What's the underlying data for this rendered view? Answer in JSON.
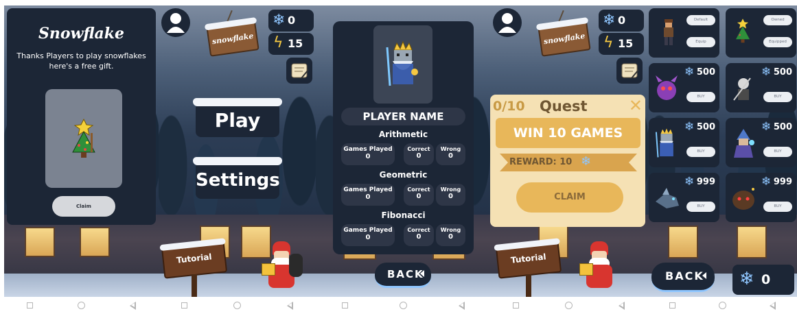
{
  "panels": {
    "gift": {
      "title": "Snowflake",
      "message": "Thanks Players to play snowflakes here's a free gift.",
      "claim_label": "Claim",
      "gift_icon": "star-tree-sprite-icon"
    },
    "main_menu": {
      "snowflakes": "0",
      "energy": "15",
      "sign_text": "snowflake",
      "play_label": "Play",
      "settings_label": "Settings",
      "tutorial_label": "Tutorial",
      "profile_icon": "user-icon",
      "quest_icon": "scroll-icon"
    },
    "profile": {
      "player_name": "PLAYER NAME",
      "back_label": "BACK",
      "sections": [
        {
          "title": "Arithmetic",
          "games_played_label": "Games Played",
          "games_played": "0",
          "correct_label": "Correct",
          "correct": "0",
          "wrong_label": "Wrong",
          "wrong": "0"
        },
        {
          "title": "Geometric",
          "games_played_label": "Games Played",
          "games_played": "0",
          "correct_label": "Correct",
          "correct": "0",
          "wrong_label": "Wrong",
          "wrong": "0"
        },
        {
          "title": "Fibonacci",
          "games_played_label": "Games Played",
          "games_played": "0",
          "correct_label": "Correct",
          "correct": "0",
          "wrong_label": "Wrong",
          "wrong": "0"
        }
      ]
    },
    "quest": {
      "snowflakes": "0",
      "energy": "15",
      "sign_text": "snowflake",
      "tutorial_label": "Tutorial",
      "progress": "0/10",
      "title": "Quest",
      "close": "✕",
      "goal": "WIN 10 GAMES",
      "reward_label": "REWARD: 10",
      "claim_label": "CLAIM"
    },
    "shop": {
      "back_label": "BACK",
      "balance": "0",
      "items": [
        {
          "name": "default-character",
          "top_label": "Default",
          "button": "Equip",
          "price": ""
        },
        {
          "name": "star-tree",
          "top_label": "Owned",
          "button": "Equipped",
          "price": ""
        },
        {
          "name": "purple-monster",
          "top_label": "",
          "button": "BUY",
          "price": "500"
        },
        {
          "name": "skeleton-knight",
          "top_label": "",
          "button": "BUY",
          "price": "500"
        },
        {
          "name": "ice-king",
          "top_label": "",
          "button": "BUY",
          "price": "500"
        },
        {
          "name": "ice-wizard",
          "top_label": "",
          "button": "BUY",
          "price": "500"
        },
        {
          "name": "ice-dragon",
          "top_label": "",
          "button": "BUY",
          "price": "999"
        },
        {
          "name": "dark-beast",
          "top_label": "",
          "button": "BUY",
          "price": "999"
        }
      ]
    }
  },
  "colors": {
    "dark_panel": "#1c2636",
    "quest_gold": "#e8b75a",
    "quest_cream": "#f5e1b4",
    "snowflake_blue": "#8fc6ff"
  }
}
